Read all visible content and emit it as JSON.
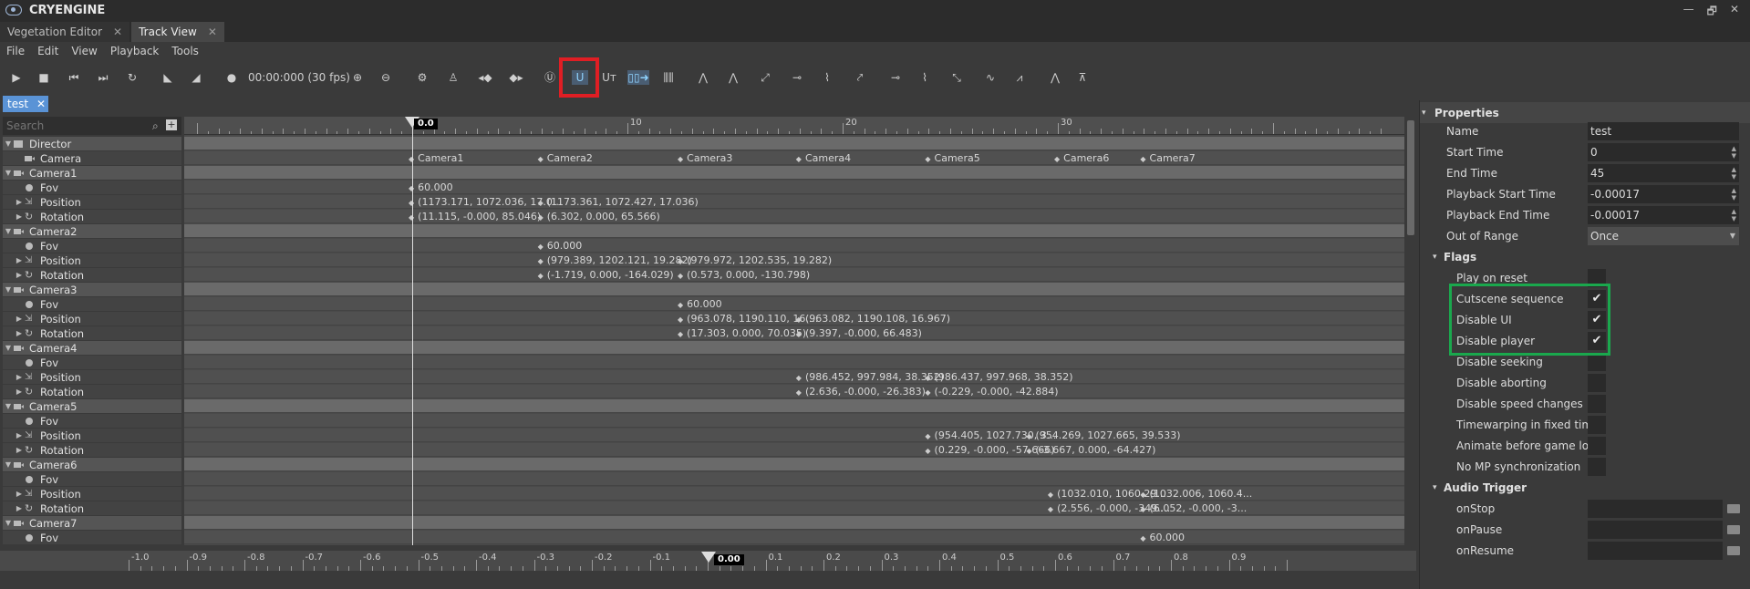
{
  "app": {
    "title": "CRYENGINE",
    "window_controls": [
      "—",
      "🗗",
      "✕"
    ]
  },
  "tabs": [
    {
      "label": "Vegetation Editor"
    },
    {
      "label": "Track View"
    }
  ],
  "menu": [
    "File",
    "Edit",
    "View",
    "Playback",
    "Tools"
  ],
  "toolbar": {
    "timecode": "00:00:000 (30 fps)",
    "highlighted_snap": "U"
  },
  "sequence_tab": {
    "label": "test"
  },
  "search": {
    "placeholder": "Search"
  },
  "tree": [
    {
      "label": "Director",
      "type": "group",
      "icon": "director"
    },
    {
      "label": "Camera",
      "type": "track",
      "icon": "camera"
    },
    {
      "label": "Camera1",
      "type": "group",
      "icon": "camera"
    },
    {
      "label": "Fov",
      "type": "track",
      "icon": "dot"
    },
    {
      "label": "Position",
      "type": "track",
      "icon": "position",
      "arrow": true
    },
    {
      "label": "Rotation",
      "type": "track",
      "icon": "rotation",
      "arrow": true
    },
    {
      "label": "Camera2",
      "type": "group",
      "icon": "camera"
    },
    {
      "label": "Fov",
      "type": "track",
      "icon": "dot"
    },
    {
      "label": "Position",
      "type": "track",
      "icon": "position",
      "arrow": true
    },
    {
      "label": "Rotation",
      "type": "track",
      "icon": "rotation",
      "arrow": true
    },
    {
      "label": "Camera3",
      "type": "group",
      "icon": "camera"
    },
    {
      "label": "Fov",
      "type": "track",
      "icon": "dot"
    },
    {
      "label": "Position",
      "type": "track",
      "icon": "position",
      "arrow": true
    },
    {
      "label": "Rotation",
      "type": "track",
      "icon": "rotation",
      "arrow": true
    },
    {
      "label": "Camera4",
      "type": "group",
      "icon": "camera"
    },
    {
      "label": "Fov",
      "type": "track",
      "icon": "dot"
    },
    {
      "label": "Position",
      "type": "track",
      "icon": "position",
      "arrow": true
    },
    {
      "label": "Rotation",
      "type": "track",
      "icon": "rotation",
      "arrow": true
    },
    {
      "label": "Camera5",
      "type": "group",
      "icon": "camera"
    },
    {
      "label": "Fov",
      "type": "track",
      "icon": "dot"
    },
    {
      "label": "Position",
      "type": "track",
      "icon": "position",
      "arrow": true
    },
    {
      "label": "Rotation",
      "type": "track",
      "icon": "rotation",
      "arrow": true
    },
    {
      "label": "Camera6",
      "type": "group",
      "icon": "camera"
    },
    {
      "label": "Fov",
      "type": "track",
      "icon": "dot"
    },
    {
      "label": "Position",
      "type": "track",
      "icon": "position",
      "arrow": true
    },
    {
      "label": "Rotation",
      "type": "track",
      "icon": "rotation",
      "arrow": true
    },
    {
      "label": "Camera7",
      "type": "group",
      "icon": "camera"
    },
    {
      "label": "Fov",
      "type": "track",
      "icon": "dot"
    }
  ],
  "ruler": {
    "current": "0.0",
    "labels": [
      "10",
      "20",
      "30"
    ]
  },
  "keys": [
    {
      "row": 1,
      "time": 0,
      "text": "Camera1"
    },
    {
      "row": 1,
      "time": 6,
      "text": "Camera2"
    },
    {
      "row": 1,
      "time": 12.5,
      "text": "Camera3"
    },
    {
      "row": 1,
      "time": 18,
      "text": "Camera4"
    },
    {
      "row": 1,
      "time": 24,
      "text": "Camera5"
    },
    {
      "row": 1,
      "time": 30,
      "text": "Camera6"
    },
    {
      "row": 1,
      "time": 34,
      "text": "Camera7"
    },
    {
      "row": 3,
      "time": 0,
      "text": "60.000"
    },
    {
      "row": 4,
      "time": 0,
      "text": "(1173.171, 1072.036, 17.0..."
    },
    {
      "row": 4,
      "time": 6,
      "text": "(1173.361, 1072.427, 17.036)"
    },
    {
      "row": 5,
      "time": 0,
      "text": "(11.115, -0.000, 85.046)"
    },
    {
      "row": 5,
      "time": 6,
      "text": "(6.302, 0.000, 65.566)"
    },
    {
      "row": 7,
      "time": 6,
      "text": "60.000"
    },
    {
      "row": 8,
      "time": 6,
      "text": "(979.389, 1202.121, 19.282)"
    },
    {
      "row": 8,
      "time": 12.5,
      "text": "(979.972, 1202.535, 19.282)"
    },
    {
      "row": 9,
      "time": 6,
      "text": "(-1.719, 0.000, -164.029)"
    },
    {
      "row": 9,
      "time": 12.5,
      "text": "(0.573, 0.000, -130.798)"
    },
    {
      "row": 11,
      "time": 12.5,
      "text": "60.000"
    },
    {
      "row": 12,
      "time": 12.5,
      "text": "(963.078, 1190.110, 16...."
    },
    {
      "row": 12,
      "time": 18,
      "text": "(963.082, 1190.108, 16.967)"
    },
    {
      "row": 13,
      "time": 12.5,
      "text": "(17.303, 0.000, 70.035)"
    },
    {
      "row": 13,
      "time": 18,
      "text": "(9.397, -0.000, 66.483)"
    },
    {
      "row": 16,
      "time": 18,
      "text": "(986.452, 997.984, 38.352)"
    },
    {
      "row": 16,
      "time": 24,
      "text": "(986.437, 997.968, 38.352)"
    },
    {
      "row": 17,
      "time": 18,
      "text": "(2.636, -0.000, -26.383)"
    },
    {
      "row": 17,
      "time": 24,
      "text": "(-0.229, -0.000, -42.884)"
    },
    {
      "row": 20,
      "time": 24,
      "text": "(954.405, 1027.730, 3..."
    },
    {
      "row": 20,
      "time": 28.7,
      "text": "(954.269, 1027.665, 39.533)"
    },
    {
      "row": 21,
      "time": 24,
      "text": "(0.229, -0.000, -57.666)"
    },
    {
      "row": 21,
      "time": 28.7,
      "text": "(-3.667, 0.000, -64.427)"
    },
    {
      "row": 24,
      "time": 29.7,
      "text": "(1032.010, 1060.29..."
    },
    {
      "row": 24,
      "time": 34,
      "text": "(1032.006, 1060.4..."
    },
    {
      "row": 25,
      "time": 29.7,
      "text": "(2.556, -0.000, -349...."
    },
    {
      "row": 25,
      "time": 34,
      "text": "(6.052, -0.000, -3..."
    },
    {
      "row": 27,
      "time": 34,
      "text": "60.000"
    }
  ],
  "bottom_ruler": {
    "labels": [
      "-1.0",
      "-0.9",
      "-0.8",
      "-0.7",
      "-0.6",
      "-0.5",
      "-0.4",
      "-0.3",
      "-0.2",
      "-0.1",
      "0.1",
      "0.2",
      "0.3",
      "0.4",
      "0.5",
      "0.6",
      "0.7",
      "0.8",
      "0.9"
    ],
    "current": "0.00"
  },
  "properties": {
    "header": "Properties",
    "fields": [
      {
        "label": "Name",
        "value": "test"
      },
      {
        "label": "Start Time",
        "value": "0",
        "spin": true
      },
      {
        "label": "End Time",
        "value": "45",
        "spin": true
      },
      {
        "label": "Playback Start Time",
        "value": "-0.00017",
        "spin": true
      },
      {
        "label": "Playback End Time",
        "value": "-0.00017",
        "spin": true
      },
      {
        "label": "Out of Range",
        "value": "Once",
        "dropdown": true
      }
    ],
    "flags_header": "Flags",
    "flags": [
      {
        "label": "Play on reset",
        "checked": false
      },
      {
        "label": "Cutscene sequence",
        "checked": true
      },
      {
        "label": "Disable UI",
        "checked": true
      },
      {
        "label": "Disable player",
        "checked": true
      },
      {
        "label": "Disable seeking",
        "checked": false
      },
      {
        "label": "Disable aborting",
        "checked": false
      },
      {
        "label": "Disable speed changes",
        "checked": false
      },
      {
        "label": "Timewarping in fixed tim",
        "checked": false
      },
      {
        "label": "Animate before game lo",
        "checked": false
      },
      {
        "label": "No MP synchronization",
        "checked": false
      }
    ],
    "audio_header": "Audio Trigger",
    "audio": [
      {
        "label": "onStop"
      },
      {
        "label": "onPause"
      },
      {
        "label": "onResume"
      }
    ]
  }
}
